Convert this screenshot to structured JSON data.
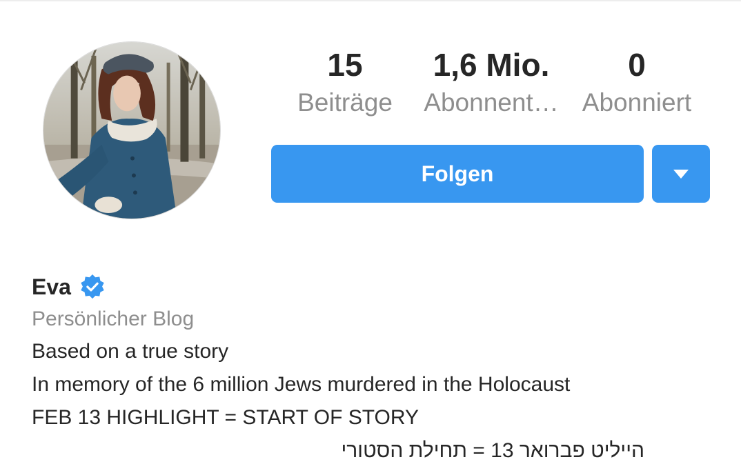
{
  "profile": {
    "name": "Eva",
    "category": "Persönlicher Blog",
    "verified_icon": "verified-badge-icon",
    "accent_color": "#3897f0"
  },
  "stats": {
    "posts": {
      "value": "15",
      "label": "Beiträge"
    },
    "followers": {
      "value": "1,6 Mio.",
      "label": "Abonnent…"
    },
    "following": {
      "value": "0",
      "label": "Abonniert"
    }
  },
  "actions": {
    "follow_label": "Folgen",
    "dropdown_icon": "triangle-down-icon"
  },
  "bio": {
    "line1": "Based on a true story",
    "line2": "In memory of the 6 million Jews murdered in the Holocaust",
    "line3": "FEB 13 HIGHLIGHT = START OF STORY",
    "line4": "הייליט פברואר 13 = תחילת הסטורי"
  }
}
